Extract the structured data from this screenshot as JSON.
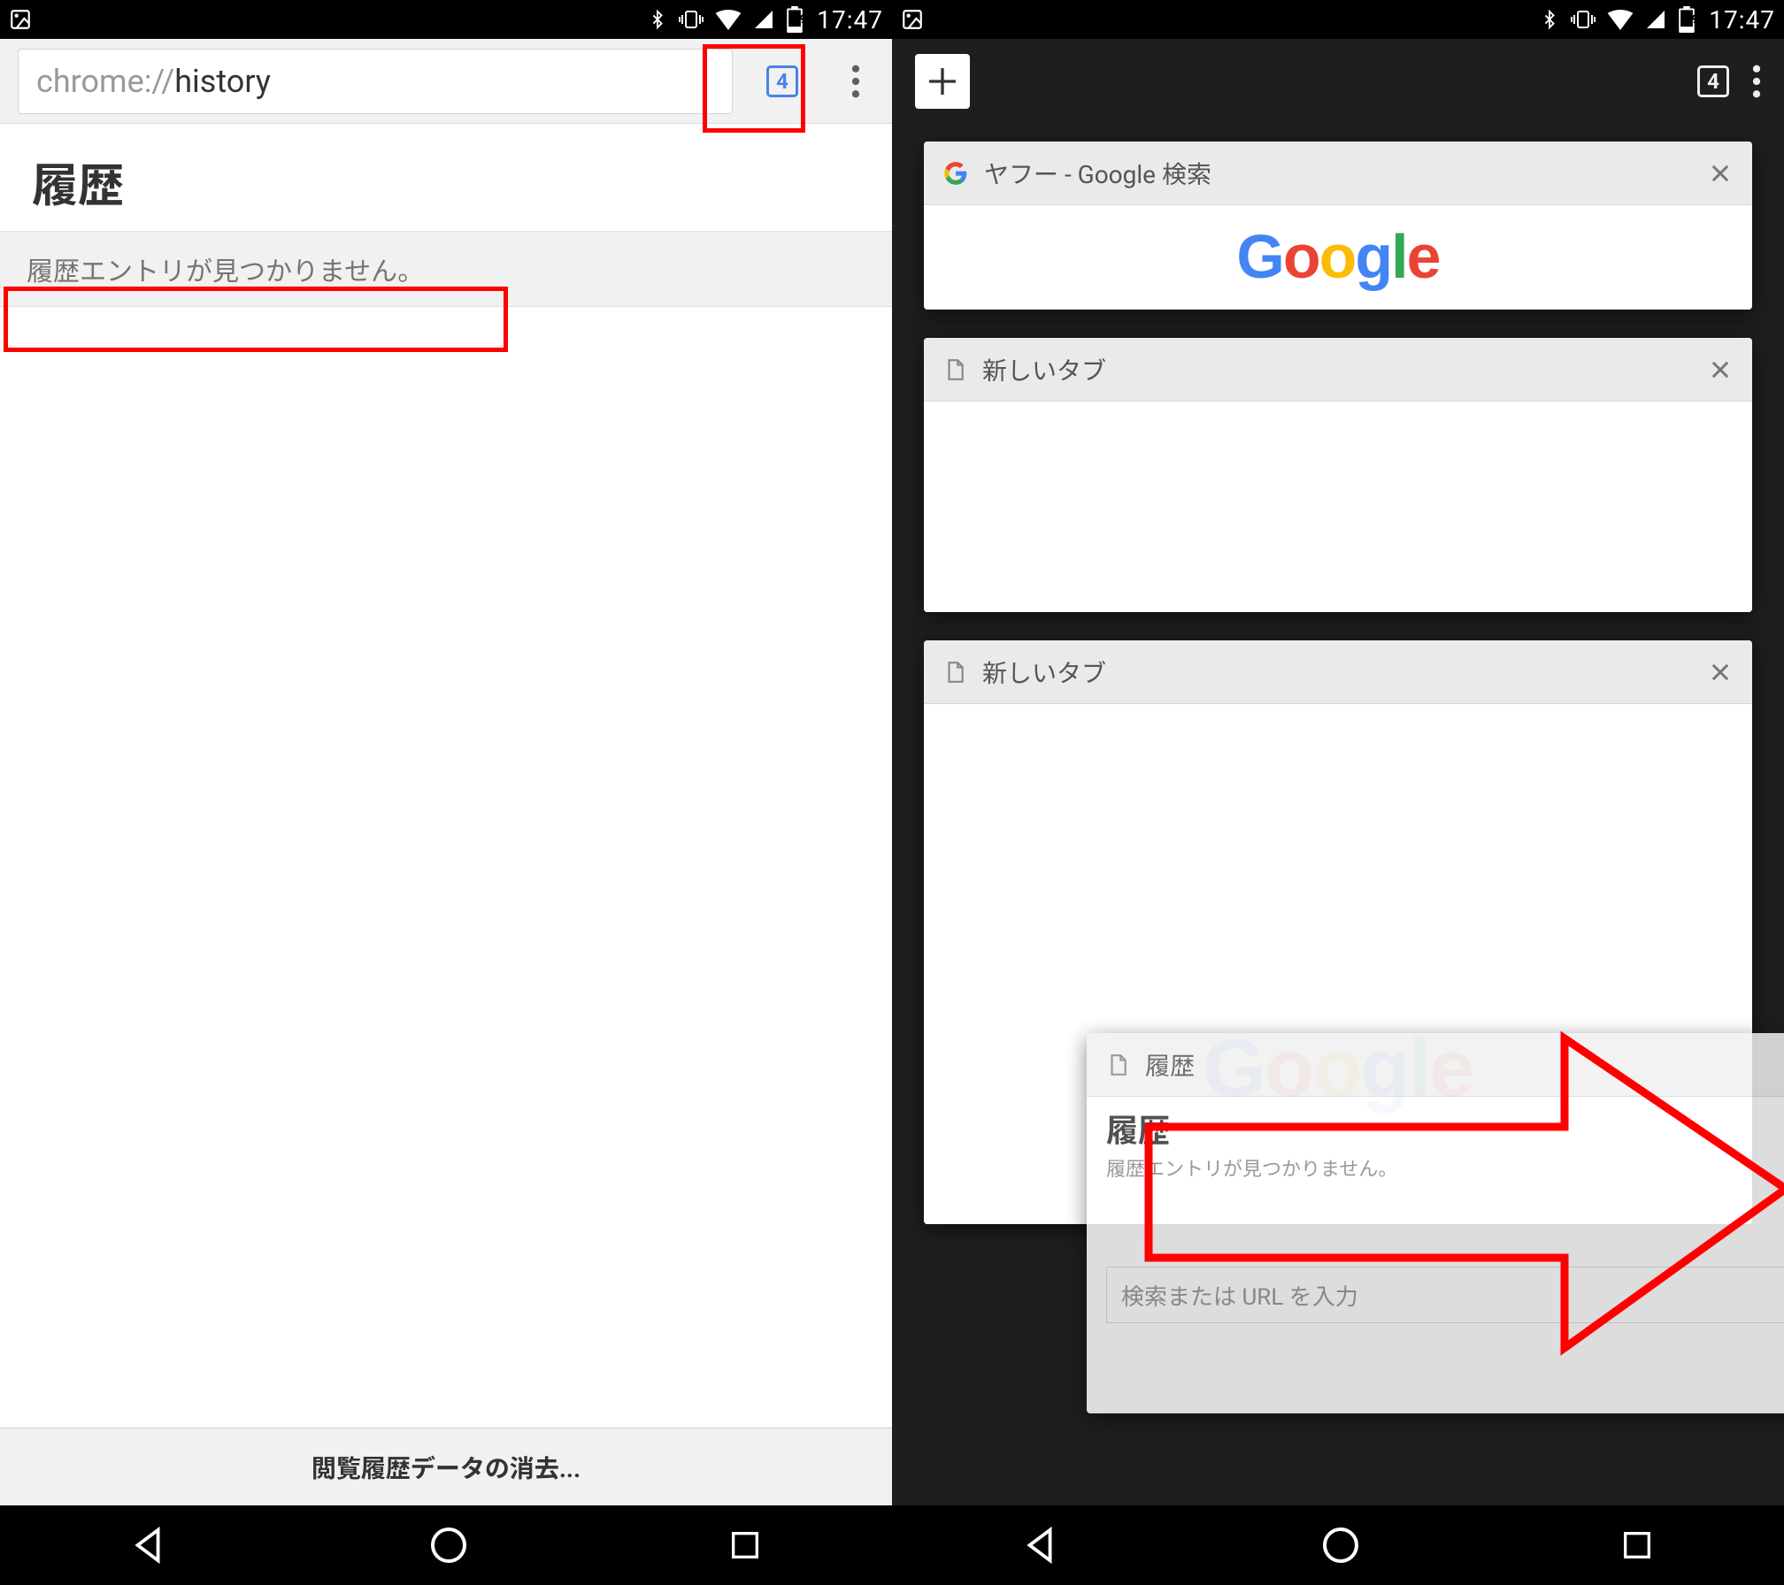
{
  "status": {
    "time": "17:47",
    "battery_level": "19"
  },
  "left": {
    "url_scheme": "chrome://",
    "url_path": "history",
    "tab_count": "4",
    "history_title": "履歴",
    "history_empty": "履歴エントリが見つかりません。",
    "clear_data": "閲覧履歴データの消去..."
  },
  "right": {
    "tab_count": "4",
    "tabs": [
      {
        "title": "ヤフー - Google 検索",
        "icon": "google"
      },
      {
        "title": "新しいタブ",
        "icon": "page"
      },
      {
        "title": "新しいタブ",
        "icon": "page"
      },
      {
        "title": "履歴",
        "icon": "page"
      }
    ],
    "dragging_card": {
      "history_title": "履歴",
      "history_empty": "履歴エントリが見つかりません。",
      "search_placeholder": "検索または URL を入力"
    }
  }
}
